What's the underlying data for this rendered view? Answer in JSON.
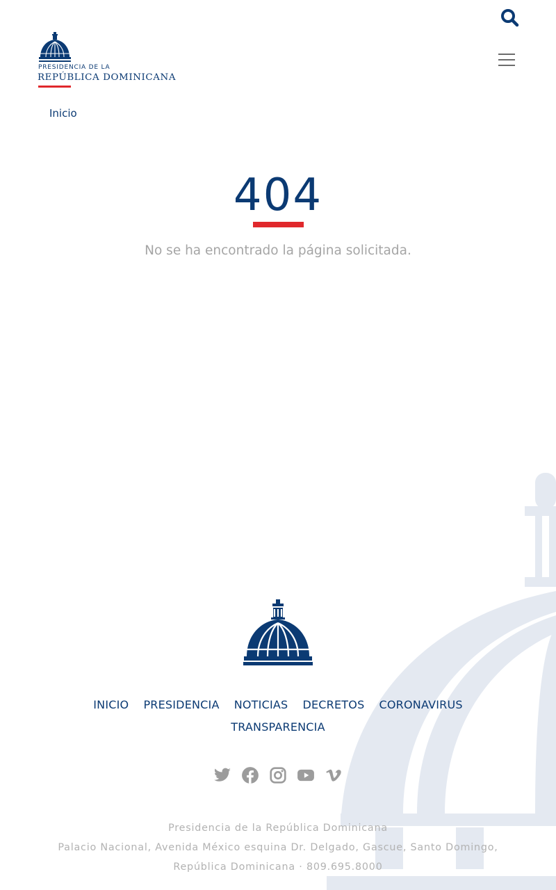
{
  "header": {
    "logo_line1": "PRESIDENCIA DE LA",
    "logo_line2": "REPÚBLICA DOMINICANA",
    "search_icon": "search-icon",
    "menu_icon": "hamburger-menu-icon"
  },
  "breadcrumb": {
    "home_label": "Inicio"
  },
  "error": {
    "code": "404",
    "message": "No se ha encontrado la página solicitada."
  },
  "footer": {
    "nav": [
      {
        "label": "INICIO"
      },
      {
        "label": "PRESIDENCIA"
      },
      {
        "label": "NOTICIAS"
      },
      {
        "label": "DECRETOS"
      },
      {
        "label": "CORONAVIRUS"
      },
      {
        "label": "TRANSPARENCIA"
      }
    ],
    "social_icons": [
      "twitter-icon",
      "facebook-icon",
      "instagram-icon",
      "youtube-icon",
      "vimeo-icon"
    ],
    "address": {
      "line1": "Presidencia de la República Dominicana",
      "line2": "Palacio Nacional, Avenida México esquina Dr. Delgado, Gascue, Santo Domingo,",
      "line3": "República Dominicana · 809.695.8000"
    }
  },
  "colors": {
    "brand_blue": "#0b3a73",
    "accent_red": "#e0282c",
    "muted_text": "#a5a5a5",
    "watermark": "#e4e9f1"
  }
}
